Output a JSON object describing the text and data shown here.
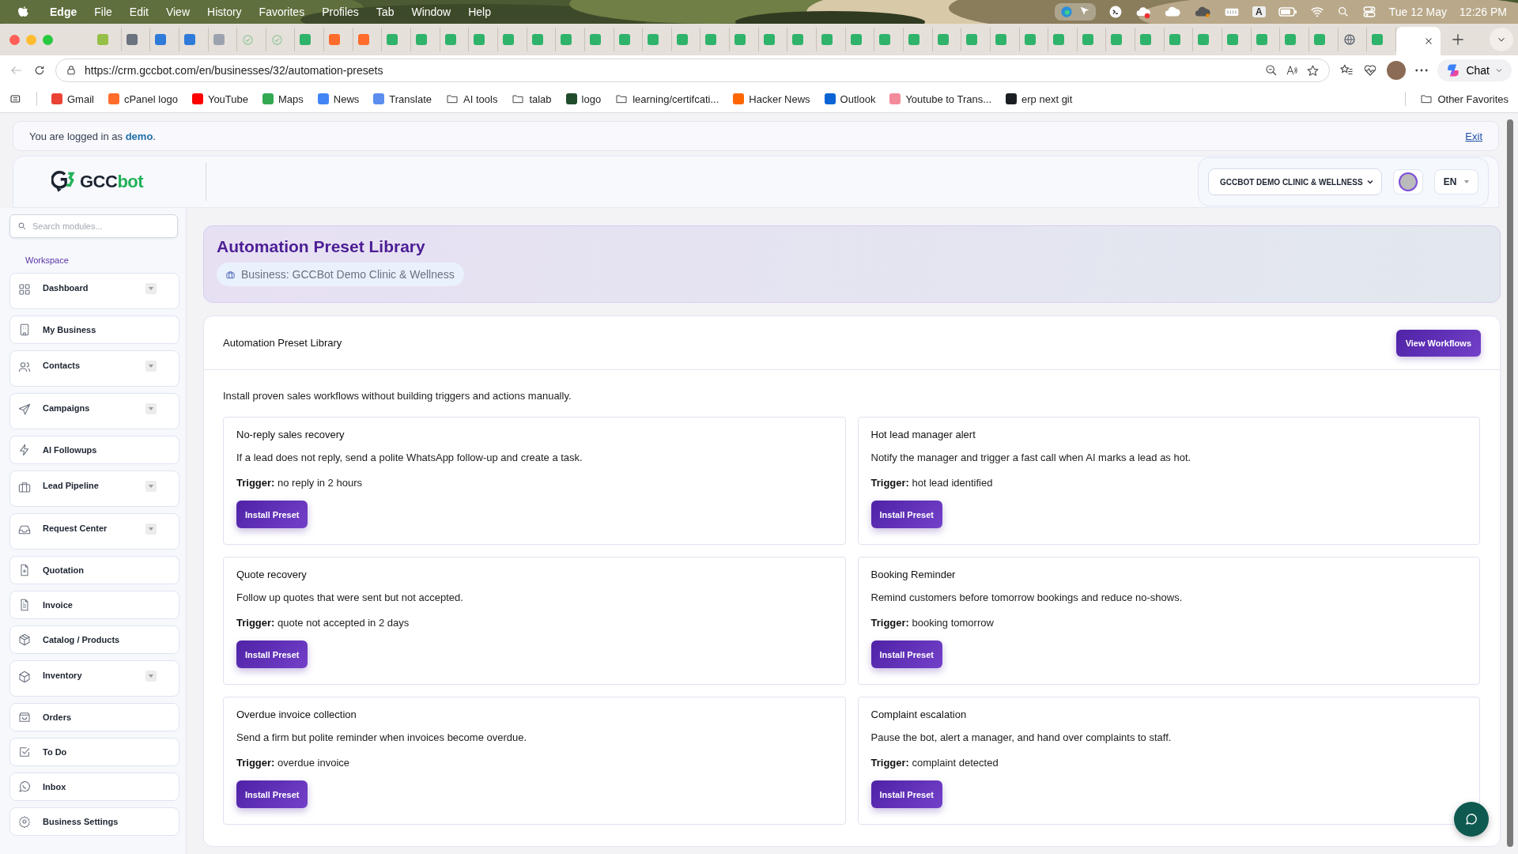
{
  "menu_bar": {
    "items": [
      {
        "label": "Edge",
        "selected": true
      },
      {
        "label": "File",
        "selected": false
      },
      {
        "label": "Edit",
        "selected": false
      },
      {
        "label": "View",
        "selected": false
      },
      {
        "label": "History",
        "selected": false
      },
      {
        "label": "Favorites",
        "selected": false
      },
      {
        "label": "Profiles",
        "selected": false
      },
      {
        "label": "Tab",
        "selected": false
      },
      {
        "label": "Window",
        "selected": false
      },
      {
        "label": "Help",
        "selected": false
      }
    ],
    "input_source": "A",
    "date": "Tue 12 May",
    "time": "12:26 PM"
  },
  "tabs": [
    {
      "kind": "shopify",
      "selected": false
    },
    {
      "kind": "calendar",
      "selected": false
    },
    {
      "kind": "outlook",
      "selected": false
    },
    {
      "kind": "outlook",
      "selected": false
    },
    {
      "kind": "chatgpt",
      "selected": false
    },
    {
      "kind": "check",
      "selected": false
    },
    {
      "kind": "check",
      "selected": false
    },
    {
      "kind": "gccbot",
      "selected": false
    },
    {
      "kind": "cpanel",
      "selected": false
    },
    {
      "kind": "cpanel",
      "selected": false
    },
    {
      "kind": "gccbot",
      "selected": false
    },
    {
      "kind": "gccbot",
      "selected": false
    },
    {
      "kind": "gccbot",
      "selected": false
    },
    {
      "kind": "gccbot",
      "selected": false
    },
    {
      "kind": "gccbot",
      "selected": false
    },
    {
      "kind": "gccbot",
      "selected": false
    },
    {
      "kind": "gccbot",
      "selected": false
    },
    {
      "kind": "gccbot",
      "selected": false
    },
    {
      "kind": "gccbot",
      "selected": false
    },
    {
      "kind": "gccbot",
      "selected": false
    },
    {
      "kind": "gccbot",
      "selected": false
    },
    {
      "kind": "gccbot",
      "selected": false
    },
    {
      "kind": "gccbot",
      "selected": false
    },
    {
      "kind": "gccbot",
      "selected": false
    },
    {
      "kind": "gccbot",
      "selected": false
    },
    {
      "kind": "gccbot",
      "selected": false
    },
    {
      "kind": "gccbot",
      "selected": false
    },
    {
      "kind": "gccbot",
      "selected": false
    },
    {
      "kind": "gccbot",
      "selected": false
    },
    {
      "kind": "gccbot",
      "selected": false
    },
    {
      "kind": "gccbot",
      "selected": false
    },
    {
      "kind": "gccbot",
      "selected": false
    },
    {
      "kind": "gccbot",
      "selected": false
    },
    {
      "kind": "gccbot",
      "selected": false
    },
    {
      "kind": "gccbot",
      "selected": false
    },
    {
      "kind": "gccbot",
      "selected": false
    },
    {
      "kind": "gccbot",
      "selected": false
    },
    {
      "kind": "gccbot",
      "selected": false
    },
    {
      "kind": "gccbot",
      "selected": false
    },
    {
      "kind": "gccbot",
      "selected": false
    },
    {
      "kind": "gccbot",
      "selected": false
    },
    {
      "kind": "gccbot",
      "selected": false
    },
    {
      "kind": "gccbot",
      "selected": false
    },
    {
      "kind": "globe",
      "selected": false
    },
    {
      "kind": "gccbot",
      "selected": false
    },
    {
      "selected": true
    }
  ],
  "toolbar": {
    "url": "https://crm.gccbot.com/en/businesses/32/automation-presets",
    "chat_label": "Chat"
  },
  "bookmarks": [
    {
      "label": "Gmail",
      "kind": "site",
      "color": "#ea4335"
    },
    {
      "label": "cPanel logo",
      "kind": "site",
      "color": "#ff6c2c"
    },
    {
      "label": "YouTube",
      "kind": "site",
      "color": "#ff0000"
    },
    {
      "label": "Maps",
      "kind": "site",
      "color": "#34a853"
    },
    {
      "label": "News",
      "kind": "site",
      "color": "#4285f4"
    },
    {
      "label": "Translate",
      "kind": "site",
      "color": "#5b8def"
    },
    {
      "label": "AI tools",
      "kind": "folder"
    },
    {
      "label": "talab",
      "kind": "folder"
    },
    {
      "label": "logo",
      "kind": "site",
      "color": "#1f4d2b"
    },
    {
      "label": "learning/certifcati...",
      "kind": "folder"
    },
    {
      "label": "Hacker News",
      "kind": "site",
      "color": "#ff6600"
    },
    {
      "label": "Outlook",
      "kind": "site",
      "color": "#0a64d6"
    },
    {
      "label": "Youtube to Trans...",
      "kind": "site",
      "color": "#f28b9b"
    },
    {
      "label": "erp next git",
      "kind": "site",
      "color": "#1b1f23"
    }
  ],
  "other_favorites": "Other Favorites",
  "login_bar": {
    "text": "You are logged in as ",
    "user": "demo",
    "suffix": ".",
    "exit": "Exit"
  },
  "header": {
    "logo_text": [
      "GCC",
      "bot"
    ],
    "business_select": "GCCBOT DEMO CLINIC & WELLNESS",
    "language": "EN"
  },
  "sidebar": {
    "search": {
      "placeholder": "Search modules..."
    },
    "section": "Workspace",
    "items": [
      {
        "label": "Dashboard",
        "has_submenu": true
      },
      {
        "label": "My Business",
        "has_submenu": false
      },
      {
        "label": "Contacts",
        "has_submenu": true
      },
      {
        "label": "Campaigns",
        "has_submenu": true
      },
      {
        "label": "AI Followups",
        "has_submenu": false
      },
      {
        "label": "Lead Pipeline",
        "has_submenu": true
      },
      {
        "label": "Request Center",
        "has_submenu": true
      },
      {
        "label": "Quotation",
        "has_submenu": false
      },
      {
        "label": "Invoice",
        "has_submenu": false
      },
      {
        "label": "Catalog / Products",
        "has_submenu": false
      },
      {
        "label": "Inventory",
        "has_submenu": true
      },
      {
        "label": "Orders",
        "has_submenu": false
      },
      {
        "label": "To Do",
        "has_submenu": false
      },
      {
        "label": "Inbox",
        "has_submenu": false
      },
      {
        "label": "Business Settings",
        "has_submenu": false
      }
    ]
  },
  "page_header": {
    "title": "Automation Preset Library",
    "business": "Business: GCCBot Demo Clinic & Wellness"
  },
  "library": {
    "title": "Automation Preset Library",
    "view_button": "View Workflows",
    "intro": "Install proven sales workflows without building triggers and actions manually.",
    "presets": [
      {
        "title": "No-reply sales recovery",
        "description": "If a lead does not reply, send a polite WhatsApp follow-up and create a task.",
        "trigger": "**Trigger:** no reply in 2 hours",
        "button": "Install Preset"
      },
      {
        "title": "Hot lead manager alert",
        "description": "Notify the manager and trigger a fast call when AI marks a lead as hot.",
        "trigger": "**Trigger:** hot lead identified",
        "button": "Install Preset"
      },
      {
        "title": "Quote recovery",
        "description": "Follow up quotes that were sent but not accepted.",
        "trigger": "**Trigger:** quote not accepted in 2 days",
        "button": "Install Preset"
      },
      {
        "title": "Booking Reminder",
        "description": "Remind customers before tomorrow bookings and reduce no-shows.",
        "trigger": "**Trigger:** booking tomorrow",
        "button": "Install Preset"
      },
      {
        "title": "Overdue invoice collection",
        "description": "Send a firm but polite reminder when invoices become overdue.",
        "trigger": "**Trigger:** overdue invoice",
        "button": "Install Preset"
      },
      {
        "title": "Complaint escalation",
        "description": "Pause the bot, alert a manager, and hand over complaints to staff.",
        "trigger": "**Trigger:** complaint detected",
        "button": "Install Preset"
      }
    ]
  }
}
